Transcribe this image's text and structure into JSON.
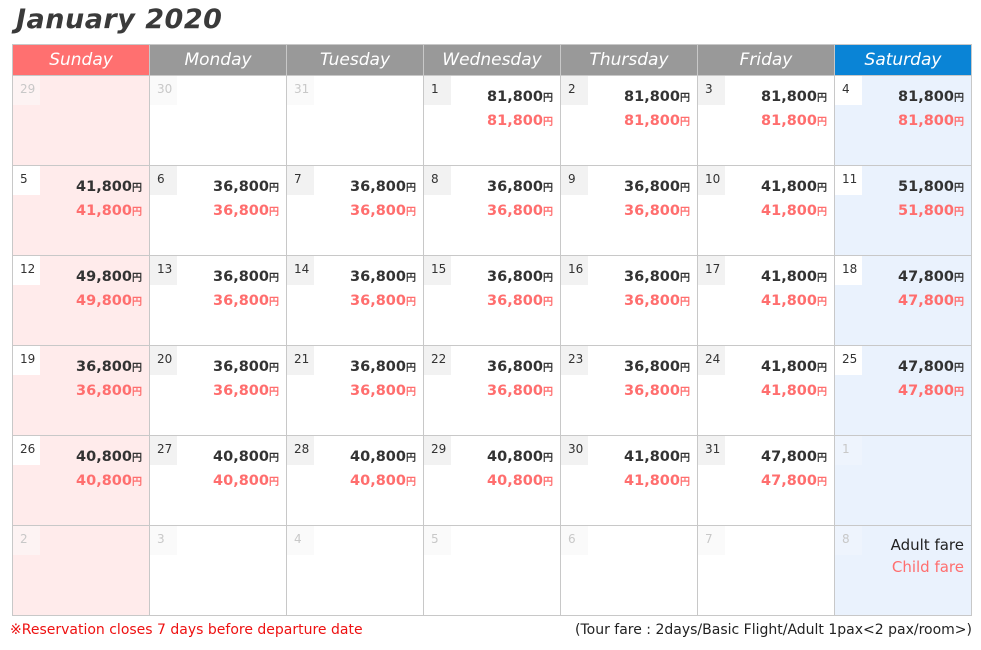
{
  "title": "January 2020",
  "weekdays": [
    "Sunday",
    "Monday",
    "Tuesday",
    "Wednesday",
    "Thursday",
    "Friday",
    "Saturday"
  ],
  "currency_symbol": "円",
  "colors": {
    "sunday_header": "#ff7070",
    "weekday_header": "#999999",
    "saturday_header": "#0a84d6",
    "sunday_cell": "#ffebeb",
    "saturday_cell": "#eaf2fd",
    "adult_fare": "#333333",
    "child_fare": "#ff6e6e",
    "note": "#ee1111"
  },
  "weeks": [
    [
      {
        "day": "29",
        "other": true
      },
      {
        "day": "30",
        "other": true
      },
      {
        "day": "31",
        "other": true
      },
      {
        "day": "1",
        "adult": "81,800",
        "child": "81,800"
      },
      {
        "day": "2",
        "adult": "81,800",
        "child": "81,800"
      },
      {
        "day": "3",
        "adult": "81,800",
        "child": "81,800"
      },
      {
        "day": "4",
        "adult": "81,800",
        "child": "81,800"
      }
    ],
    [
      {
        "day": "5",
        "adult": "41,800",
        "child": "41,800"
      },
      {
        "day": "6",
        "adult": "36,800",
        "child": "36,800"
      },
      {
        "day": "7",
        "adult": "36,800",
        "child": "36,800"
      },
      {
        "day": "8",
        "adult": "36,800",
        "child": "36,800"
      },
      {
        "day": "9",
        "adult": "36,800",
        "child": "36,800"
      },
      {
        "day": "10",
        "adult": "41,800",
        "child": "41,800"
      },
      {
        "day": "11",
        "adult": "51,800",
        "child": "51,800"
      }
    ],
    [
      {
        "day": "12",
        "adult": "49,800",
        "child": "49,800"
      },
      {
        "day": "13",
        "adult": "36,800",
        "child": "36,800"
      },
      {
        "day": "14",
        "adult": "36,800",
        "child": "36,800"
      },
      {
        "day": "15",
        "adult": "36,800",
        "child": "36,800"
      },
      {
        "day": "16",
        "adult": "36,800",
        "child": "36,800"
      },
      {
        "day": "17",
        "adult": "41,800",
        "child": "41,800"
      },
      {
        "day": "18",
        "adult": "47,800",
        "child": "47,800"
      }
    ],
    [
      {
        "day": "19",
        "adult": "36,800",
        "child": "36,800"
      },
      {
        "day": "20",
        "adult": "36,800",
        "child": "36,800"
      },
      {
        "day": "21",
        "adult": "36,800",
        "child": "36,800"
      },
      {
        "day": "22",
        "adult": "36,800",
        "child": "36,800"
      },
      {
        "day": "23",
        "adult": "36,800",
        "child": "36,800"
      },
      {
        "day": "24",
        "adult": "41,800",
        "child": "41,800"
      },
      {
        "day": "25",
        "adult": "47,800",
        "child": "47,800"
      }
    ],
    [
      {
        "day": "26",
        "adult": "40,800",
        "child": "40,800"
      },
      {
        "day": "27",
        "adult": "40,800",
        "child": "40,800"
      },
      {
        "day": "28",
        "adult": "40,800",
        "child": "40,800"
      },
      {
        "day": "29",
        "adult": "40,800",
        "child": "40,800"
      },
      {
        "day": "30",
        "adult": "41,800",
        "child": "41,800"
      },
      {
        "day": "31",
        "adult": "47,800",
        "child": "47,800"
      },
      {
        "day": "1",
        "other": true
      }
    ],
    [
      {
        "day": "2",
        "other": true
      },
      {
        "day": "3",
        "other": true
      },
      {
        "day": "4",
        "other": true
      },
      {
        "day": "5",
        "other": true
      },
      {
        "day": "6",
        "other": true
      },
      {
        "day": "7",
        "other": true
      },
      {
        "day": "8",
        "other": true,
        "legend": true
      }
    ]
  ],
  "legend": {
    "adult_label": "Adult fare",
    "child_label": "Child fare"
  },
  "footer": {
    "reservation_note": "※Reservation closes 7 days before departure date",
    "tour_fare_note": "(Tour fare : 2days/Basic Flight/Adult 1pax<2 pax/room>)"
  }
}
